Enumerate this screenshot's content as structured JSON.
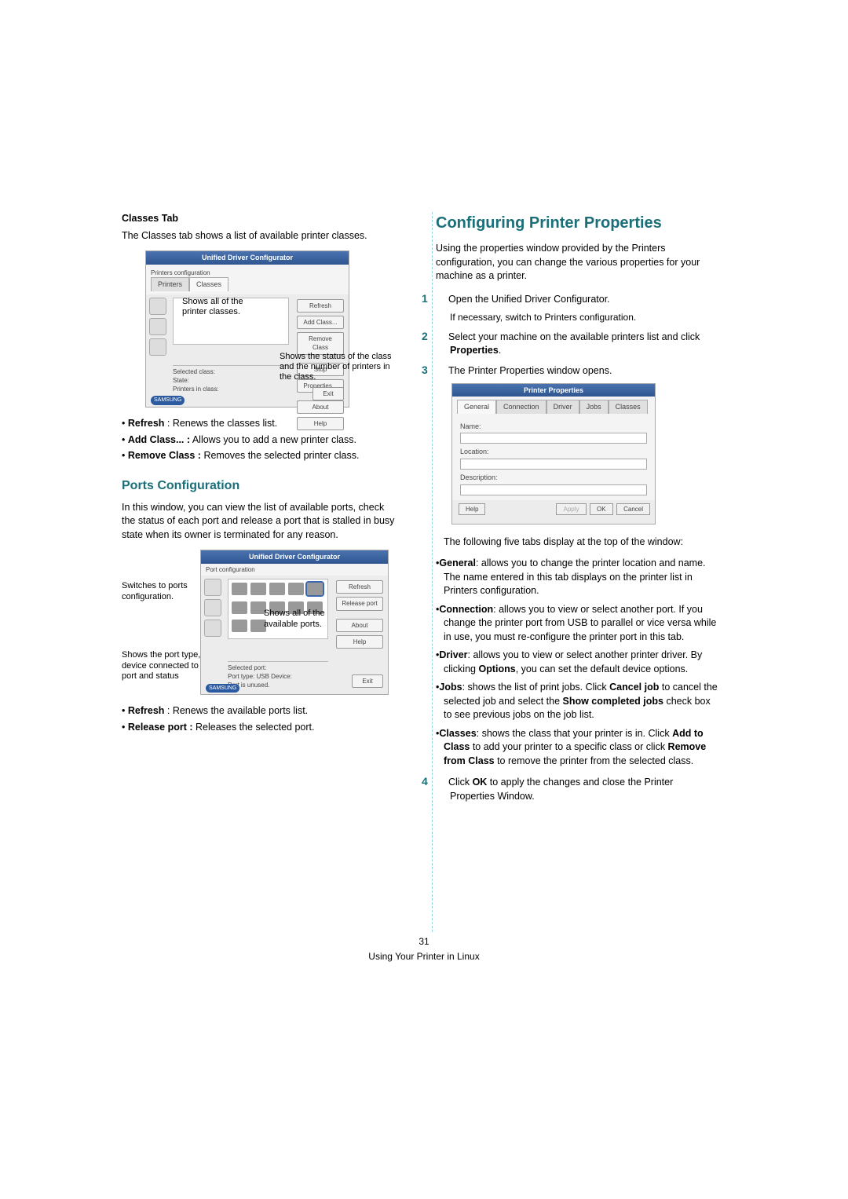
{
  "left": {
    "classes_heading": "Classes Tab",
    "classes_intro": "The Classes tab shows a list of available printer classes.",
    "mock1": {
      "title": "Unified Driver Configurator",
      "tab_printers": "Printers",
      "tab_classes": "Classes",
      "callout_top": "Shows all of the printer classes.",
      "btn_refresh": "Refresh",
      "btn_add": "Add Class...",
      "btn_remove": "Remove Class",
      "btn_stop": "Stop",
      "btn_props": "Properties...",
      "btn_about": "About",
      "btn_help": "Help",
      "section_label": "Selected class:",
      "state": "State:",
      "printers_in": "Printers in class:",
      "callout_bottom": "Shows the status of the class and the number of printers in the class.",
      "exit": "Exit"
    },
    "classes_bullets": {
      "refresh_b": "Refresh",
      "refresh_t": " : Renews the classes list.",
      "add_b": "Add Class... :",
      "add_t": " Allows you to add a new printer class.",
      "remove_b": "Remove Class :",
      "remove_t": " Removes the selected printer class."
    },
    "ports_heading": "Ports Configuration",
    "ports_intro": "In this window, you can view the list of available ports, check the status of each port and release a port that is stalled in busy state when its owner is terminated for any reason.",
    "mock2": {
      "title": "Unified Driver Configurator",
      "section": "Port configuration",
      "callout_left_top": "Switches to ports configuration.",
      "callout_right": "Shows all of the available ports.",
      "callout_left_bottom": "Shows the port type, device connected to the port and status",
      "btn_refresh": "Refresh",
      "btn_release": "Release port",
      "btn_about": "About",
      "btn_help": "Help",
      "selected": "Selected port:",
      "port_type": "Port type: USB   Device:",
      "port_status": "Port is unused.",
      "exit": "Exit"
    },
    "ports_bullets": {
      "refresh_b": "Refresh",
      "refresh_t": " : Renews the available ports list.",
      "release_b": "Release port :",
      "release_t": " Releases the selected port."
    }
  },
  "right": {
    "heading": "Configuring Printer Properties",
    "intro": "Using the properties window provided by the Printers configuration, you can change the various properties for your machine as a printer.",
    "step1": "Open the Unified Driver Configurator.",
    "step1_sub": "If necessary, switch to Printers configuration.",
    "step2_a": "Select your machine on the available printers list and click ",
    "step2_b": "Properties",
    "step2_c": ".",
    "step3": "The Printer Properties window opens.",
    "mock3": {
      "title": "Printer Properties",
      "tab_general": "General",
      "tab_conn": "Connection",
      "tab_driver": "Driver",
      "tab_jobs": "Jobs",
      "tab_classes": "Classes",
      "lbl_name": "Name:",
      "lbl_location": "Location:",
      "lbl_desc": "Description:",
      "btn_help": "Help",
      "btn_apply": "Apply",
      "btn_ok": "OK",
      "btn_cancel": "Cancel"
    },
    "tabs_intro": "The following five tabs display at the top of the window:",
    "tab_general_b": "General",
    "tab_general_t": ": allows you to change the printer location and name. The name entered in this tab displays on the printer list in Printers configuration.",
    "tab_conn_b": "Connection",
    "tab_conn_t": ": allows you to view or select another port. If you change the printer port from USB to parallel or vice versa while in use, you must re-configure the printer port in this tab.",
    "tab_driver_b": "Driver",
    "tab_driver_t_a": ": allows you to view or select another printer driver. By clicking ",
    "tab_driver_t_b": "Options",
    "tab_driver_t_c": ", you can set the default device options.",
    "tab_jobs_b": "Jobs",
    "tab_jobs_t_a": ": shows the list of print jobs. Click ",
    "tab_jobs_t_b": "Cancel job",
    "tab_jobs_t_c": " to cancel the selected job and select the ",
    "tab_jobs_t_d": "Show completed jobs",
    "tab_jobs_t_e": " check box to see previous jobs on the job list.",
    "tab_classes_b": "Classes",
    "tab_classes_t_a": ": shows the class that your printer is in. Click ",
    "tab_classes_t_b": "Add to Class",
    "tab_classes_t_c": " to add your printer to a specific class or click ",
    "tab_classes_t_d": "Remove from Class",
    "tab_classes_t_e": " to remove the printer from the selected class.",
    "step4_a": "Click ",
    "step4_b": "OK",
    "step4_c": " to apply the changes and close the Printer Properties Window."
  },
  "footer": {
    "page": "31",
    "line": "Using Your Printer in Linux"
  }
}
